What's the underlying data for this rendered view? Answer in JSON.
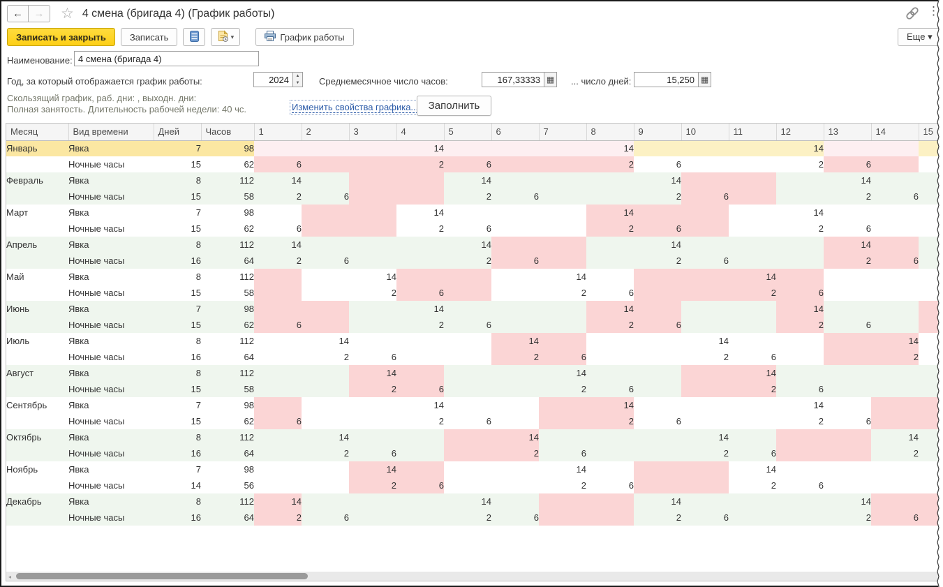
{
  "window": {
    "title": "4 смена (бригада 4) (График работы)"
  },
  "icons": {
    "back": "←",
    "forward": "→",
    "favorite_star": "☆",
    "link": "chain-icon",
    "menu_dots": "⋮",
    "calc": "▦",
    "spin_up": "▲",
    "spin_down": "▼",
    "dropdown_caret": "▾",
    "scroll_left": "◂"
  },
  "toolbar": {
    "save_close_label": "Записать и закрыть",
    "save_label": "Записать",
    "print_schedule_label": "График работы",
    "more_label": "Еще ▾"
  },
  "fields": {
    "name_label": "Наименование:",
    "name_value": "4 смена (бригада 4)",
    "year_label": "Год, за который отображается график работы:",
    "year_value": "2024",
    "avg_hours_label": "Среднемесячное число часов:",
    "avg_hours_value": "167,33333",
    "avg_days_label": "... число дней:",
    "avg_days_value": "15,250"
  },
  "notes": {
    "line1": "Скользящий график, раб. дни: , выходн. дни:",
    "line2": "Полная занятость. Длительность рабочей недели: 40 чс."
  },
  "actions": {
    "change_props_link": "Изменить свойства графика...",
    "fill_button": "Заполнить"
  },
  "colors": {
    "accent_yellow": "#fdd21c",
    "selected_left": "#fbe7a2",
    "selected_workday": "#fcf1c4",
    "selected_weekend": "#fdeff1",
    "weekend_pink": "#fbd5d5",
    "month_alt_green": "#eff6ee",
    "link_blue": "#2c5ba8",
    "note_olive": "#75786a"
  },
  "table": {
    "headers": [
      "Месяц",
      "Вид времени",
      "Дней",
      "Часов"
    ],
    "day_headers": [
      "1",
      "2",
      "3",
      "4",
      "5",
      "6",
      "7",
      "8",
      "9",
      "10",
      "11",
      "12",
      "13",
      "14",
      "15"
    ],
    "row_types": {
      "attendance": "Явка",
      "night": "Ночные часы"
    },
    "months": [
      {
        "name": "Январь",
        "selected": true,
        "weekend": [
          1,
          2,
          3,
          4,
          5,
          6,
          7,
          8,
          13,
          14
        ],
        "yavka": {
          "days": "7",
          "hours": "98",
          "vals": {
            "4": 14,
            "8": 14,
            "12": 14
          }
        },
        "night": {
          "days": "15",
          "hours": "62",
          "vals": {
            "1": 6,
            "4": 2,
            "5": 6,
            "8": 2,
            "9": 6,
            "12": 2,
            "13": 6
          }
        }
      },
      {
        "name": "Февраль",
        "weekend": [
          3,
          4,
          10,
          11
        ],
        "yavka": {
          "days": "8",
          "hours": "112",
          "vals": {
            "1": 14,
            "5": 14,
            "9": 14,
            "13": 14
          }
        },
        "night": {
          "days": "15",
          "hours": "58",
          "vals": {
            "1": 2,
            "2": 6,
            "5": 2,
            "6": 6,
            "9": 2,
            "10": 6,
            "13": 2,
            "14": 6
          }
        }
      },
      {
        "name": "Март",
        "weekend": [
          2,
          3,
          8,
          9,
          10
        ],
        "yavka": {
          "days": "7",
          "hours": "98",
          "vals": {
            "4": 14,
            "8": 14,
            "12": 14
          }
        },
        "night": {
          "days": "15",
          "hours": "62",
          "vals": {
            "1": 6,
            "4": 2,
            "5": 6,
            "8": 2,
            "9": 6,
            "12": 2,
            "13": 6
          }
        }
      },
      {
        "name": "Апрель",
        "weekend": [
          6,
          7,
          13,
          14
        ],
        "yavka": {
          "days": "8",
          "hours": "112",
          "vals": {
            "1": 14,
            "5": 14,
            "9": 14,
            "13": 14
          }
        },
        "night": {
          "days": "16",
          "hours": "64",
          "vals": {
            "1": 2,
            "2": 6,
            "5": 2,
            "6": 6,
            "9": 2,
            "10": 6,
            "13": 2,
            "14": 6
          }
        }
      },
      {
        "name": "Май",
        "weekend": [
          1,
          4,
          5,
          9,
          10,
          11,
          12
        ],
        "yavka": {
          "days": "8",
          "hours": "112",
          "vals": {
            "3": 14,
            "7": 14,
            "11": 14
          }
        },
        "night": {
          "days": "15",
          "hours": "58",
          "vals": {
            "3": 2,
            "4": 6,
            "7": 2,
            "8": 6,
            "11": 2,
            "12": 6
          }
        }
      },
      {
        "name": "Июнь",
        "weekend": [
          1,
          2,
          8,
          9,
          12,
          15
        ],
        "yavka": {
          "days": "7",
          "hours": "98",
          "vals": {
            "4": 14,
            "8": 14,
            "12": 14
          }
        },
        "night": {
          "days": "15",
          "hours": "62",
          "vals": {
            "1": 6,
            "4": 2,
            "5": 6,
            "8": 2,
            "9": 6,
            "12": 2,
            "13": 6
          }
        }
      },
      {
        "name": "Июль",
        "weekend": [
          6,
          7,
          13,
          14
        ],
        "yavka": {
          "days": "8",
          "hours": "112",
          "vals": {
            "2": 14,
            "6": 14,
            "10": 14,
            "14": 14
          }
        },
        "night": {
          "days": "16",
          "hours": "64",
          "vals": {
            "2": 2,
            "3": 6,
            "6": 2,
            "7": 6,
            "10": 2,
            "11": 6,
            "14": 2
          }
        }
      },
      {
        "name": "Август",
        "weekend": [
          3,
          4,
          10,
          11
        ],
        "yavka": {
          "days": "8",
          "hours": "112",
          "vals": {
            "3": 14,
            "7": 14,
            "11": 14
          }
        },
        "night": {
          "days": "15",
          "hours": "58",
          "vals": {
            "3": 2,
            "4": 6,
            "7": 2,
            "8": 6,
            "11": 2,
            "12": 6
          }
        }
      },
      {
        "name": "Сентябрь",
        "weekend": [
          1,
          7,
          8,
          14,
          15
        ],
        "yavka": {
          "days": "7",
          "hours": "98",
          "vals": {
            "4": 14,
            "8": 14,
            "12": 14
          }
        },
        "night": {
          "days": "15",
          "hours": "62",
          "vals": {
            "1": 6,
            "4": 2,
            "5": 6,
            "8": 2,
            "9": 6,
            "12": 2,
            "13": 6
          }
        }
      },
      {
        "name": "Октябрь",
        "weekend": [
          5,
          6,
          12,
          13
        ],
        "yavka": {
          "days": "8",
          "hours": "112",
          "vals": {
            "2": 14,
            "6": 14,
            "10": 14,
            "14": 14
          }
        },
        "night": {
          "days": "16",
          "hours": "64",
          "vals": {
            "2": 2,
            "3": 6,
            "6": 2,
            "7": 6,
            "10": 2,
            "11": 6,
            "14": 2
          }
        }
      },
      {
        "name": "Ноябрь",
        "weekend": [
          3,
          4,
          9,
          10
        ],
        "yavka": {
          "days": "7",
          "hours": "98",
          "vals": {
            "3": 14,
            "7": 14,
            "11": 14
          }
        },
        "night": {
          "days": "14",
          "hours": "56",
          "vals": {
            "3": 2,
            "4": 6,
            "7": 2,
            "8": 6,
            "11": 2,
            "12": 6
          }
        }
      },
      {
        "name": "Декабрь",
        "weekend": [
          1,
          7,
          8,
          14,
          15
        ],
        "yavka": {
          "days": "8",
          "hours": "112",
          "vals": {
            "1": 14,
            "5": 14,
            "9": 14,
            "13": 14
          }
        },
        "night": {
          "days": "16",
          "hours": "64",
          "vals": {
            "1": 2,
            "2": 6,
            "5": 2,
            "6": 6,
            "9": 2,
            "10": 6,
            "13": 2,
            "14": 6
          }
        }
      }
    ]
  }
}
